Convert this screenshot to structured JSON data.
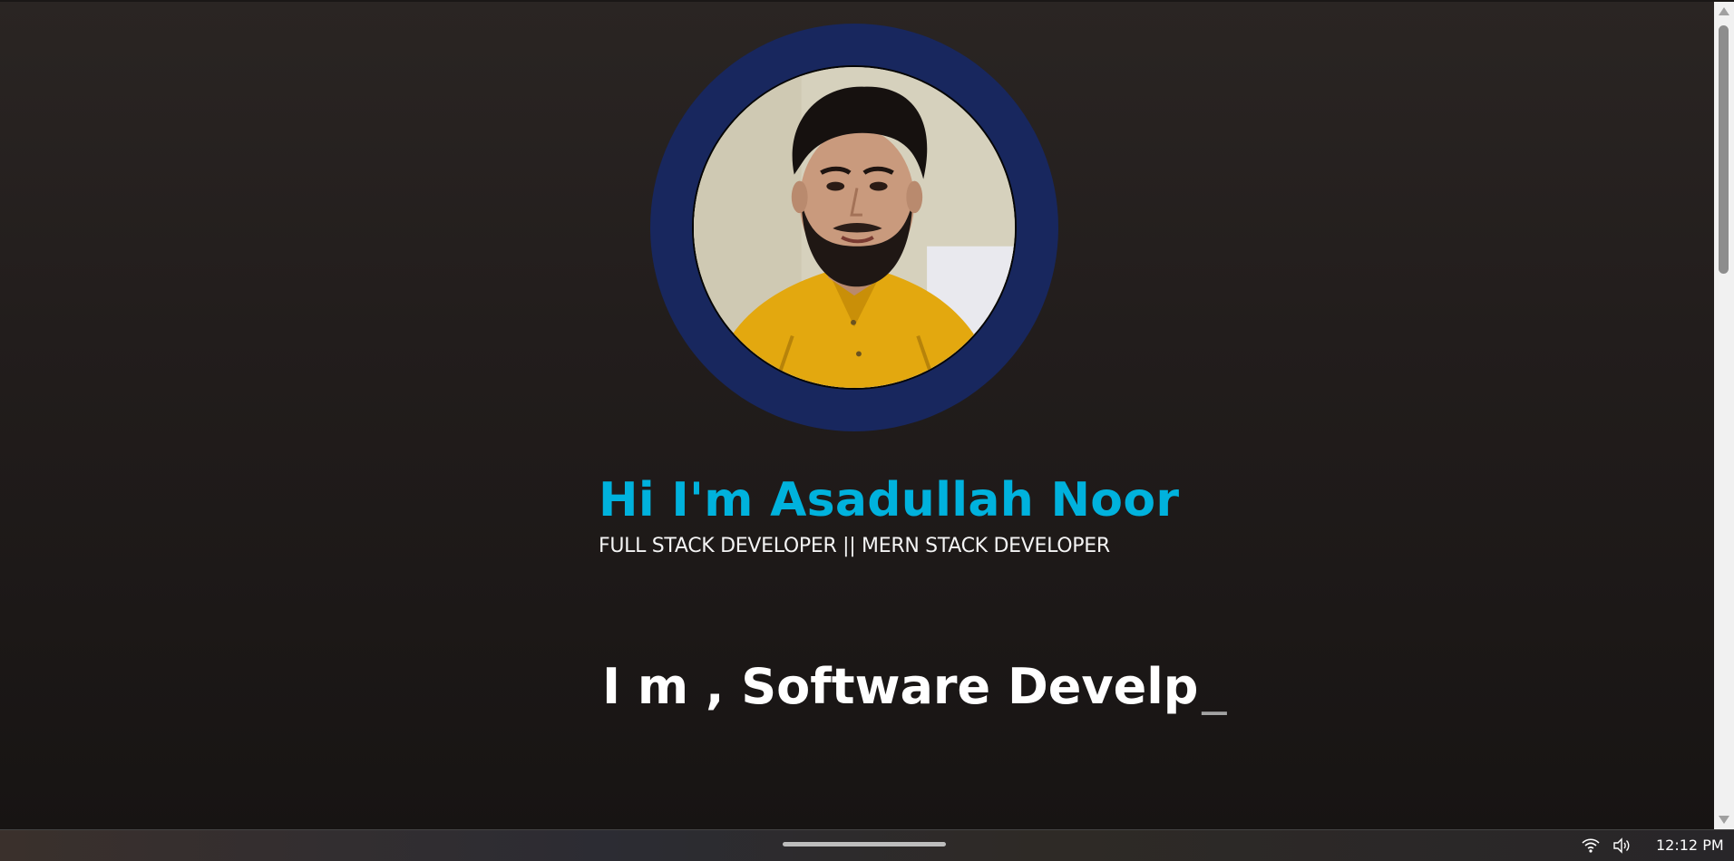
{
  "hero": {
    "greeting": "Hi I'm Asadullah Noor",
    "tagline": "FULL STACK DEVELOPER || MERN STACK DEVELOPER",
    "typing_text": "I m , Software Develp",
    "typing_cursor": "_"
  },
  "avatar": {
    "icon": "profile-photo",
    "ring_color": "#18275e"
  },
  "colors": {
    "accent": "#00b2dd",
    "background": "#1c1817"
  },
  "taskbar": {
    "clock": "12:12 PM",
    "tray_icons": [
      "wifi-icon",
      "volume-icon"
    ]
  }
}
